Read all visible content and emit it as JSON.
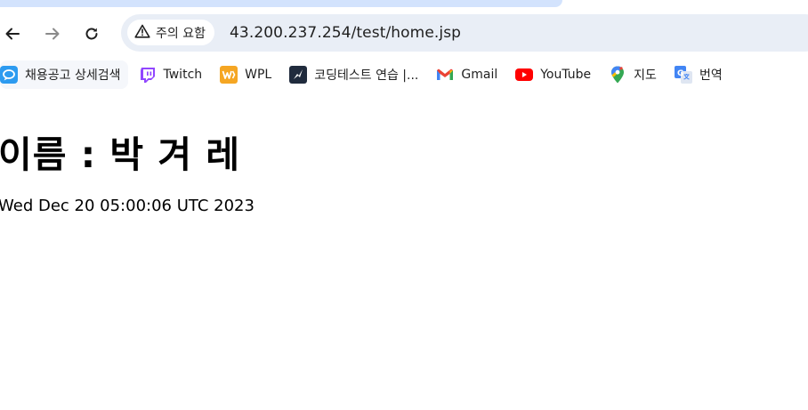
{
  "browser": {
    "security_label": "주의 요함",
    "url": "43.200.237.254/test/home.jsp",
    "bookmarks": [
      {
        "label": "채용공고 상세검색",
        "icon": "chat-bubble-icon"
      },
      {
        "label": "Twitch",
        "icon": "twitch-icon"
      },
      {
        "label": "WPL",
        "icon": "wpl-icon"
      },
      {
        "label": "코딩테스트 연습 |...",
        "icon": "programmers-icon"
      },
      {
        "label": "Gmail",
        "icon": "gmail-icon"
      },
      {
        "label": "YouTube",
        "icon": "youtube-icon"
      },
      {
        "label": "지도",
        "icon": "maps-icon"
      },
      {
        "label": "번역",
        "icon": "translate-icon"
      }
    ]
  },
  "page": {
    "heading": "이름 : 박 겨 레",
    "date": "Wed Dec 20 05:00:06 UTC 2023"
  },
  "colors": {
    "omnibox_bg": "#e9eef6",
    "tab_accent": "#d3e3fd"
  }
}
